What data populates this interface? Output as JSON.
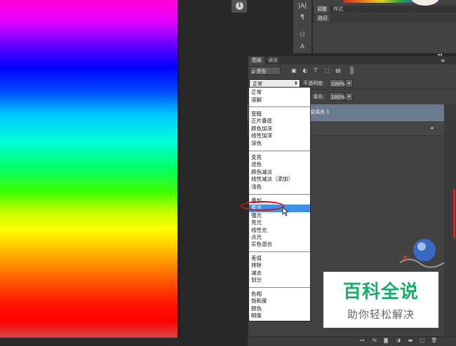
{
  "toolbar": {
    "info_icon": "i",
    "tools": [
      "|A|",
      "¶",
      "⚇",
      "A"
    ]
  },
  "top_panel": {
    "tabs": [
      "调整",
      "样式"
    ],
    "paths_label": "路径"
  },
  "layers_panel": {
    "tabs": [
      "图层",
      "通道"
    ],
    "kind_filter": "ρ 类型",
    "blend_mode": "正常",
    "opacity_label": "不透明度:",
    "opacity_value": "100%",
    "fill_label": "填充:",
    "fill_value": "100%",
    "layer_name": "变填充 1",
    "bottom_icons": [
      "link-icon",
      "fx-icon",
      "mask-icon",
      "adjustment-icon",
      "folder-icon",
      "new-layer-icon",
      "trash-icon"
    ]
  },
  "blend_modes": {
    "group1": [
      "正常",
      "溶解"
    ],
    "group2": [
      "变暗",
      "正片叠底",
      "颜色加深",
      "线性加深",
      "深色"
    ],
    "group3": [
      "变亮",
      "滤色",
      "颜色减淡",
      "线性减淡（添加）",
      "浅色"
    ],
    "group4": [
      "叠加",
      "柔光",
      "强光",
      "亮光",
      "线性光",
      "点光",
      "实色混合"
    ],
    "group5": [
      "差值",
      "排除",
      "减去",
      "划分"
    ],
    "group6": [
      "色相",
      "饱和度",
      "颜色",
      "明度"
    ],
    "selected": "柔光"
  },
  "watermark": {
    "title": "百科全说",
    "subtitle": "助你轻松解决"
  },
  "colors": {
    "highlight": "#3f8fe8",
    "annotation": "#e01010",
    "brand_green": "#1aab6a"
  }
}
